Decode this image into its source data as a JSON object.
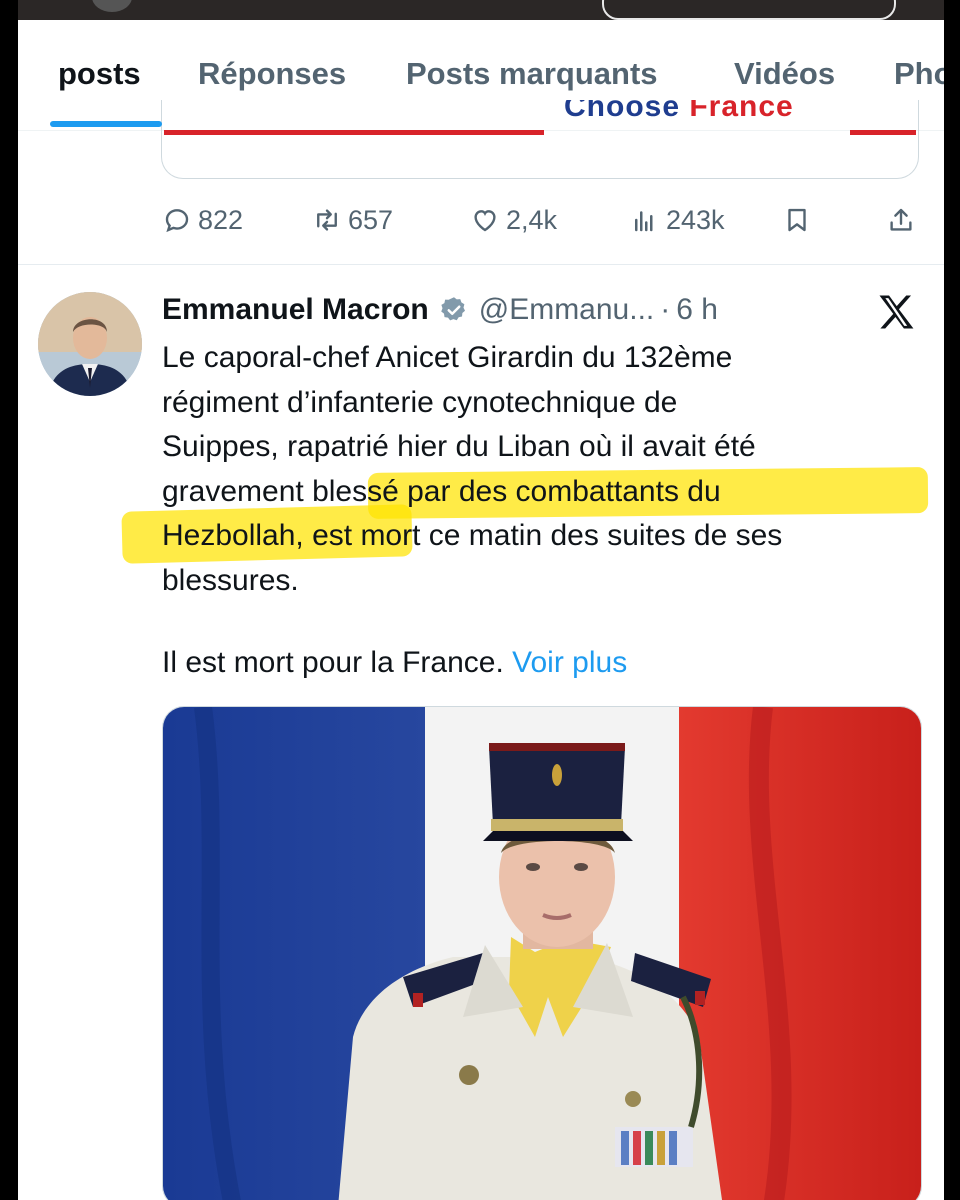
{
  "tabs": [
    {
      "label": "posts",
      "active": true
    },
    {
      "label": "Réponses",
      "active": false
    },
    {
      "label": "Posts marquants",
      "active": false
    },
    {
      "label": "Vidéos",
      "active": false
    },
    {
      "label": "Pho",
      "active": false
    }
  ],
  "quoted_card": {
    "clipped_text_1": "Choose",
    "clipped_text_2": "France"
  },
  "previous_post_actions": {
    "replies": "822",
    "reposts": "657",
    "likes": "2,4k",
    "views": "243k"
  },
  "post": {
    "author_name": "Emmanuel Macron",
    "handle": "@Emmanu...",
    "separator": "·",
    "time": "6 h",
    "lines": [
      "Le caporal-chef Anicet Girardin du 132ème",
      "régiment d’infanterie cynotechnique de",
      "Suippes, rapatrié hier du Liban où il avait été",
      "gravement blessé par des combattants du",
      "Hezbollah, est mort ce matin des suites de ses",
      "blessures."
    ],
    "paragraph2": "Il est mort pour la France.",
    "see_more": "Voir plus",
    "highlight_color": "#ffe300"
  },
  "colors": {
    "accent": "#1d9bf0",
    "text": "#0f1419",
    "muted": "#536471",
    "flag_blue": "#1f3f9a",
    "flag_white": "#f4f4f4",
    "flag_red": "#d82a24"
  }
}
